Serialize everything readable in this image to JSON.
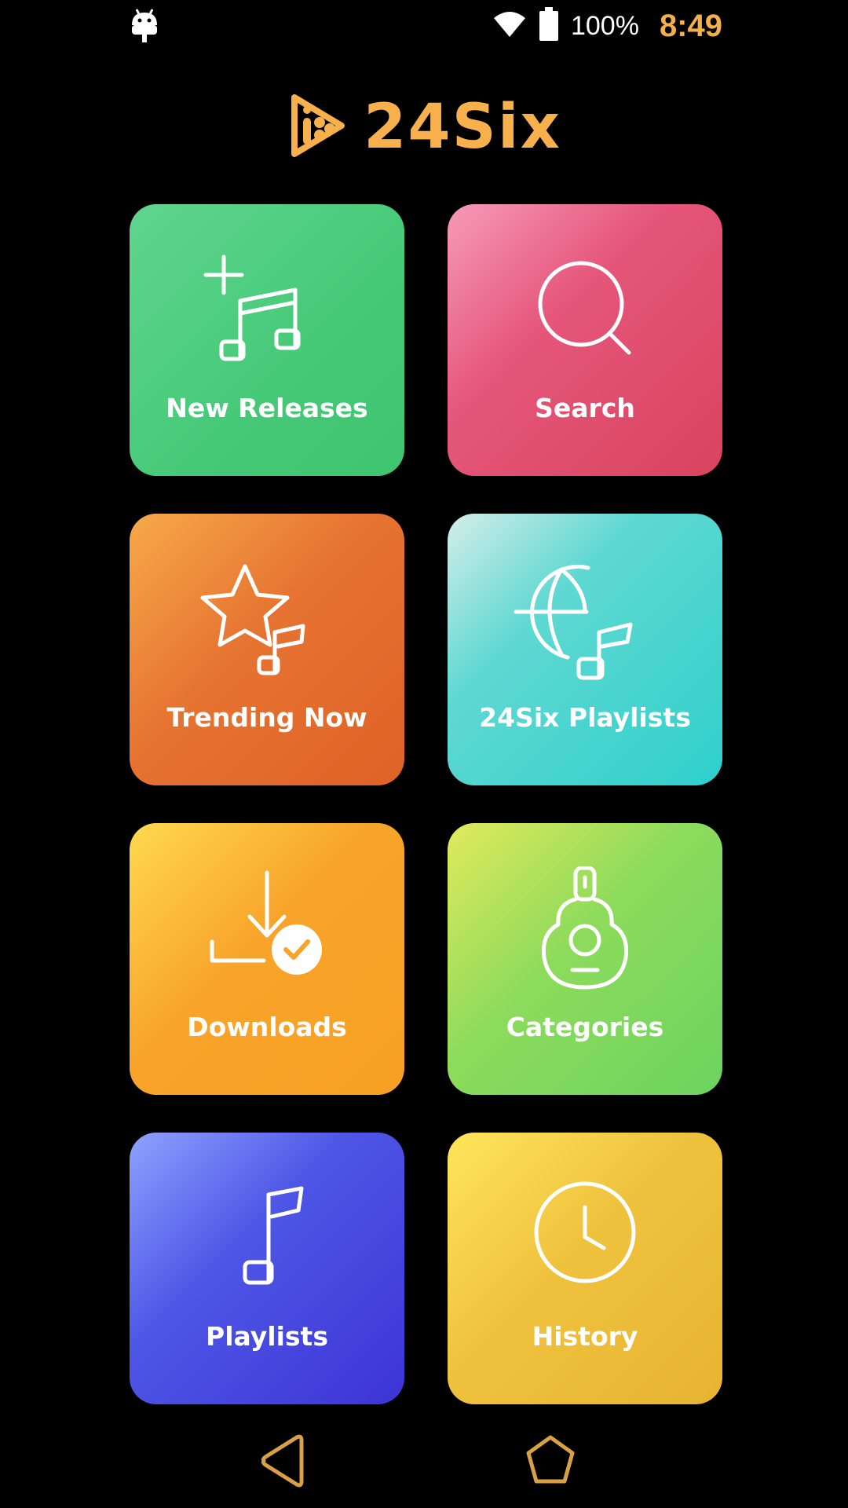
{
  "status_bar": {
    "battery_percent": "100%",
    "time": "8:49",
    "left_icon": "android-debug-icon",
    "wifi_icon": "wifi-icon",
    "battery_icon": "battery-icon"
  },
  "app": {
    "logo_text": "24Six",
    "brand_color": "#f7b04b"
  },
  "tiles": [
    {
      "label": "New Releases",
      "icon": "music-note-plus-icon",
      "color": "#4ccc7c"
    },
    {
      "label": "Search",
      "icon": "search-icon",
      "color": "#dd4b68"
    },
    {
      "label": "Trending Now",
      "icon": "star-music-icon",
      "color": "#e36b2c"
    },
    {
      "label": "24Six Playlists",
      "icon": "globe-music-icon",
      "color": "#36d2cd"
    },
    {
      "label": "Downloads",
      "icon": "download-check-icon",
      "color": "#f8a42a"
    },
    {
      "label": "Categories",
      "icon": "guitar-icon",
      "color": "#72d65e"
    },
    {
      "label": "Playlists",
      "icon": "music-note-icon",
      "color": "#3f3bd9"
    },
    {
      "label": "History",
      "icon": "clock-icon",
      "color": "#ebbc36"
    }
  ],
  "nav_bar": {
    "back_icon": "back-triangle-icon",
    "home_icon": "home-pentagon-icon",
    "icon_color": "#d9a144"
  }
}
